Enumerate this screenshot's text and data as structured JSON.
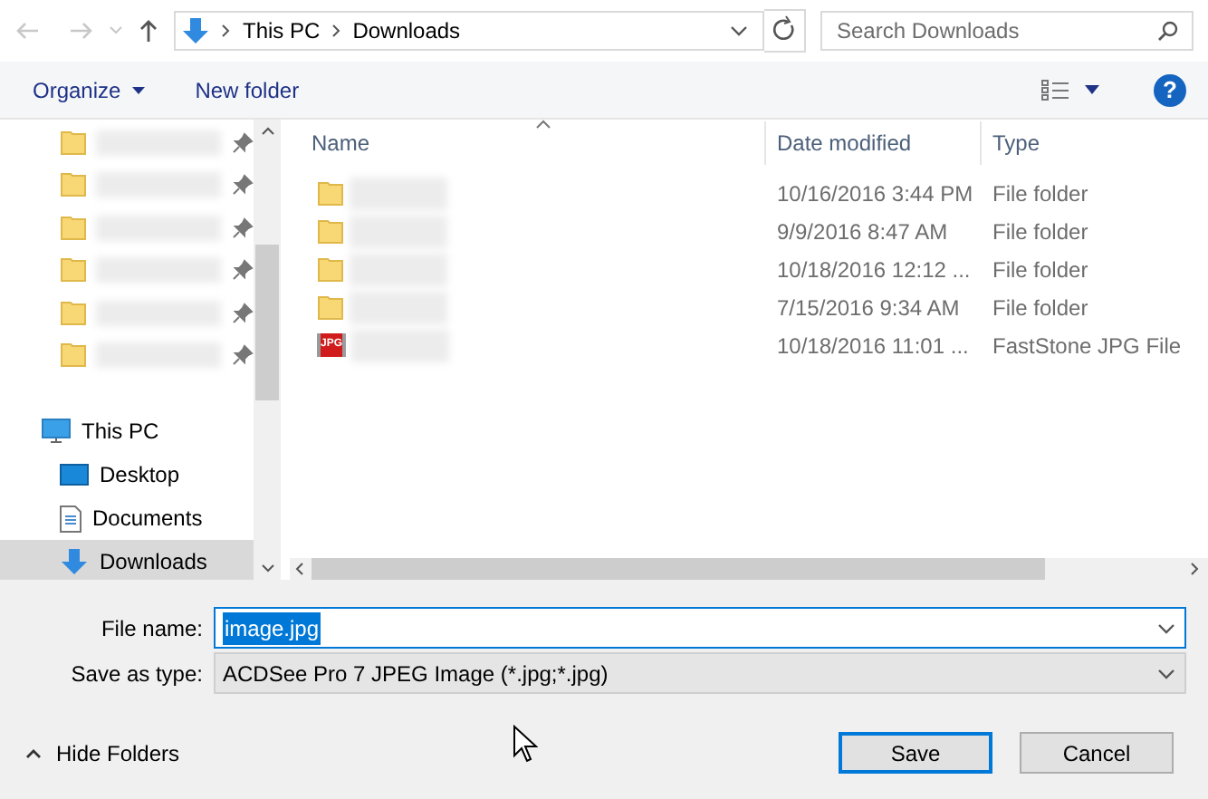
{
  "address": {
    "path": [
      "This PC",
      "Downloads"
    ]
  },
  "search": {
    "placeholder": "Search Downloads"
  },
  "toolbar": {
    "organize": "Organize",
    "new_folder": "New folder",
    "help": "?"
  },
  "nav": [
    {
      "kind": "pinned",
      "selected": false
    },
    {
      "kind": "pinned",
      "selected": false
    },
    {
      "kind": "pinned",
      "selected": false
    },
    {
      "kind": "pinned",
      "selected": false
    },
    {
      "kind": "pinned",
      "selected": false
    },
    {
      "kind": "pinned",
      "selected": false
    },
    {
      "kind": "pc",
      "label": "This PC",
      "selected": false
    },
    {
      "kind": "desktop",
      "label": "Desktop",
      "selected": false
    },
    {
      "kind": "documents",
      "label": "Documents",
      "selected": false
    },
    {
      "kind": "downloads",
      "label": "Downloads",
      "selected": true
    }
  ],
  "columns": [
    "Name",
    "Date modified",
    "Type"
  ],
  "files": [
    {
      "kind": "folder",
      "date": "10/16/2016 3:44 PM",
      "type": "File folder"
    },
    {
      "kind": "folder",
      "date": "9/9/2016 8:47 AM",
      "type": "File folder"
    },
    {
      "kind": "folder",
      "date": "10/18/2016 12:12 ...",
      "type": "File folder"
    },
    {
      "kind": "folder",
      "date": "7/15/2016 9:34 AM",
      "type": "File folder"
    },
    {
      "kind": "jpg",
      "icon_text": "JPG",
      "date": "10/18/2016 11:01 ...",
      "type": "FastStone JPG File"
    }
  ],
  "form": {
    "file_name_label": "File name:",
    "file_name": "image.jpg",
    "type_label": "Save as type:",
    "type_value": "ACDSee Pro 7 JPEG Image (*.jpg;*.jpg)"
  },
  "hide_folders": "Hide Folders",
  "buttons": [
    {
      "label": "Save",
      "default": true
    },
    {
      "label": "Cancel",
      "default": false
    }
  ]
}
